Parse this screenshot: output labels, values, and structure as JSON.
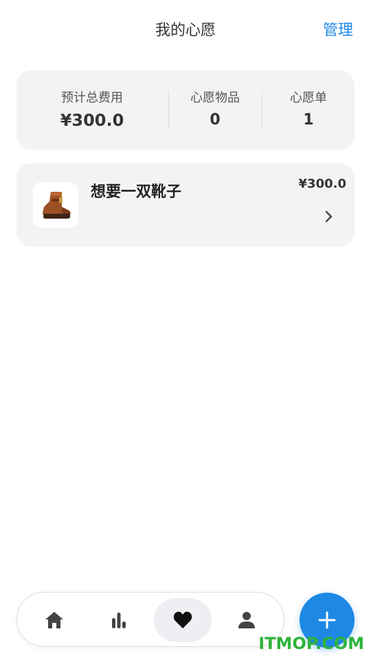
{
  "header": {
    "title": "我的心愿",
    "manage_label": "管理"
  },
  "summary": {
    "total_cost_label": "预计总费用",
    "total_cost_value": "¥300.0",
    "items_label": "心愿物品",
    "items_value": "0",
    "lists_label": "心愿单",
    "lists_value": "1"
  },
  "wishes": [
    {
      "name": "想要一双靴子",
      "price": "¥300.0",
      "icon": "boot-icon"
    }
  ],
  "nav": {
    "items": [
      {
        "icon": "home-icon",
        "active": false
      },
      {
        "icon": "bar-chart-icon",
        "active": false
      },
      {
        "icon": "heart-icon",
        "active": true
      },
      {
        "icon": "person-icon",
        "active": false
      }
    ]
  },
  "fab": {
    "icon": "plus-icon"
  },
  "watermark": {
    "text": "ITMOP.COM"
  },
  "colors": {
    "accent": "#1e88e5",
    "card_bg": "#f3f3f3",
    "text": "#222222",
    "watermark": "#2fb33a"
  }
}
